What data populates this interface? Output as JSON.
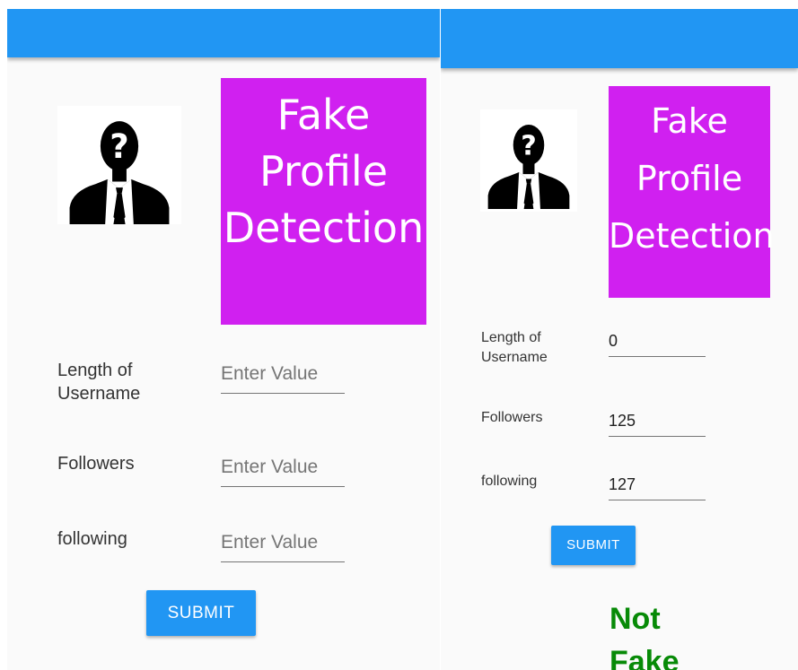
{
  "left": {
    "title_lines": [
      "Fake",
      "Profile",
      "Detection"
    ],
    "fields": [
      {
        "label_line1": "Length of",
        "label_line2": "Username",
        "placeholder": "Enter Value",
        "value": ""
      },
      {
        "label_line1": "Followers",
        "label_line2": "",
        "placeholder": "Enter Value",
        "value": ""
      },
      {
        "label_line1": "following",
        "label_line2": "",
        "placeholder": "Enter Value",
        "value": ""
      }
    ],
    "submit_label": "SUBMIT"
  },
  "right": {
    "title_lines": [
      "Fake",
      "Profile",
      "Detection"
    ],
    "fields": [
      {
        "label_line1": "Length of",
        "label_line2": "Username",
        "placeholder": "",
        "value": "0"
      },
      {
        "label_line1": "Followers",
        "label_line2": "",
        "placeholder": "",
        "value": "125"
      },
      {
        "label_line1": "following",
        "label_line2": "",
        "placeholder": "",
        "value": "127"
      }
    ],
    "submit_label": "SUBMIT",
    "result_lines": [
      "Not",
      "Fake"
    ]
  },
  "colors": {
    "app_bar": "#2196f3",
    "title_banner": "#d020f0",
    "button": "#2196f3",
    "result_text": "#078a07"
  },
  "icons": {
    "avatar": "unknown-person-icon"
  }
}
